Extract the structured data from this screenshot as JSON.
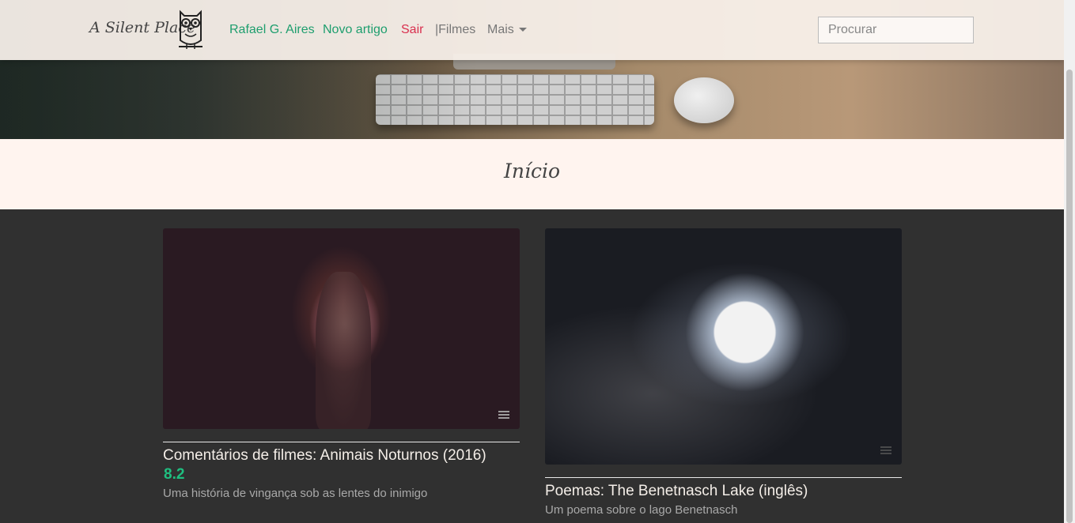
{
  "navbar": {
    "brand": "A Silent Place",
    "logo_icon": "owl-icon",
    "links": {
      "user": "Rafael G. Aires",
      "new_article": "Novo artigo",
      "logout": "Sair",
      "films": "|Filmes",
      "more": "Mais"
    },
    "search_placeholder": "Procurar"
  },
  "page": {
    "title": "Início"
  },
  "cards": [
    {
      "title": "Comentários de filmes: Animais Noturnos (2016)",
      "rating": "8.2",
      "subtitle": "Uma história de vingança sob as lentes do inimigo"
    },
    {
      "title": "Poemas: The Benetnasch Lake (inglês)",
      "subtitle": "Um poema sobre o lago Benetnasch"
    }
  ],
  "colors": {
    "accent_green": "#1e9e6e",
    "logout_red": "#d9304f",
    "rating_green": "#1fbf80"
  }
}
